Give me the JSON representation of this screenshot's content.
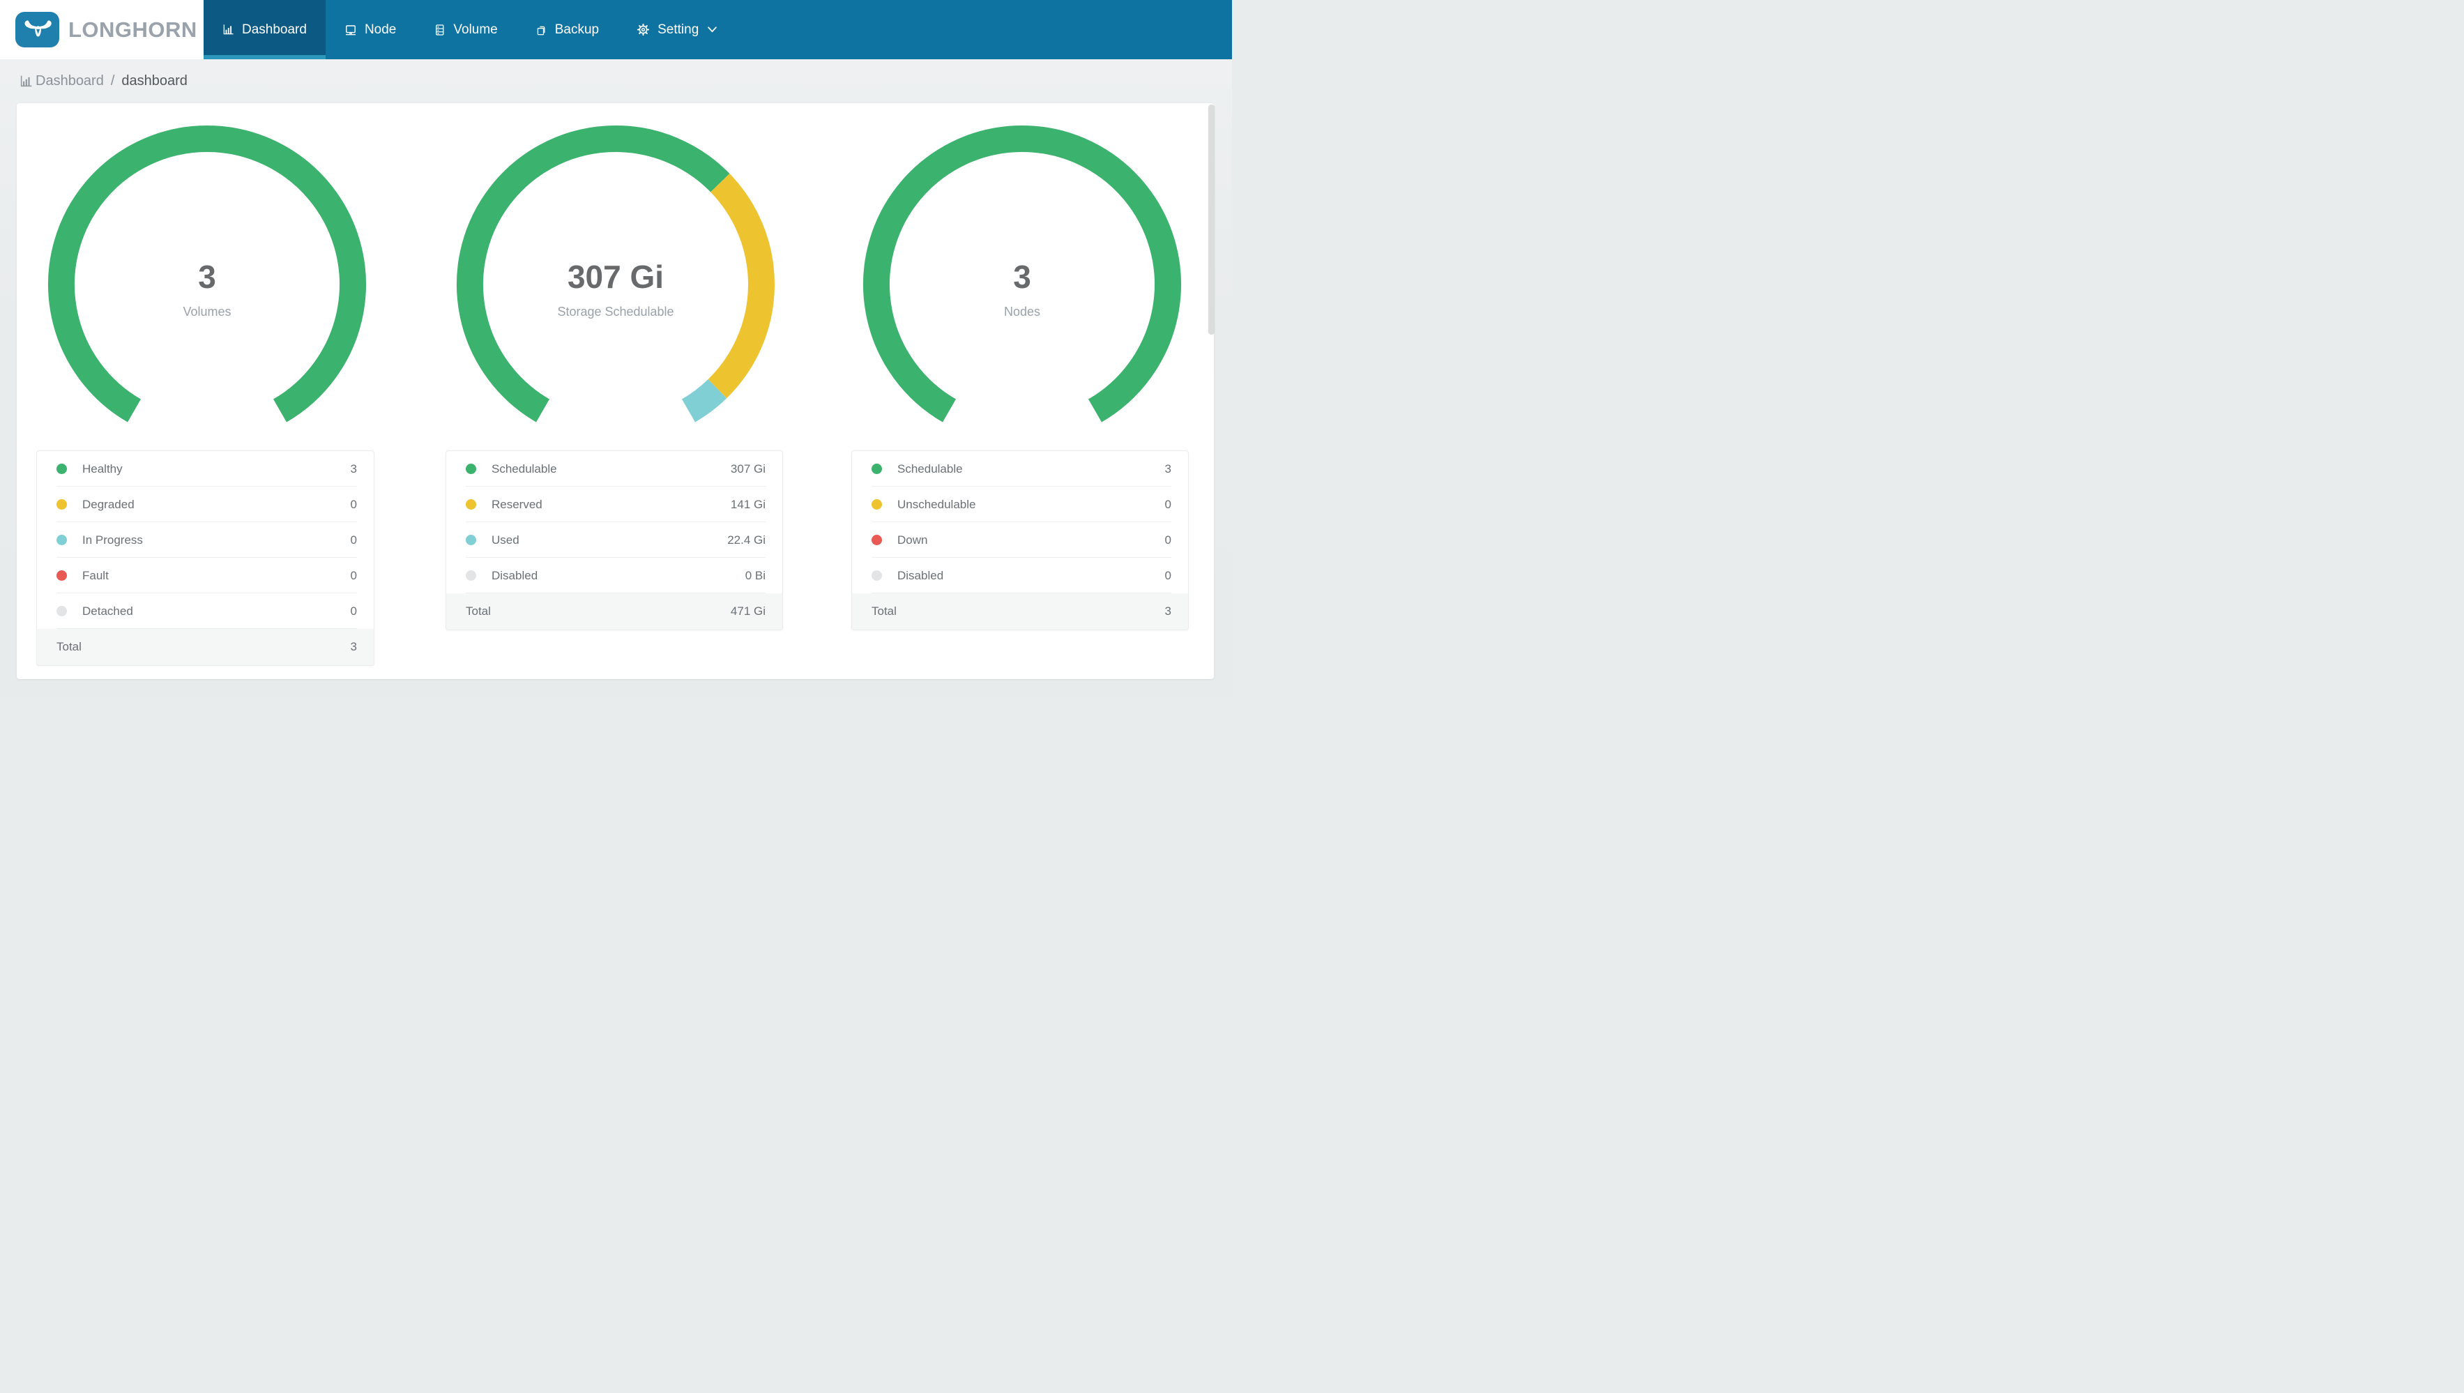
{
  "brand": {
    "name": "LONGHORN",
    "logo_icon": "longhorn-bull-icon"
  },
  "nav": {
    "items": [
      {
        "id": "dashboard",
        "label": "Dashboard",
        "icon": "bar-chart-icon",
        "active": true,
        "dropdown": false
      },
      {
        "id": "node",
        "label": "Node",
        "icon": "node-icon",
        "active": false,
        "dropdown": false
      },
      {
        "id": "volume",
        "label": "Volume",
        "icon": "volume-icon",
        "active": false,
        "dropdown": false
      },
      {
        "id": "backup",
        "label": "Backup",
        "icon": "backup-icon",
        "active": false,
        "dropdown": false
      },
      {
        "id": "setting",
        "label": "Setting",
        "icon": "gear-icon",
        "active": false,
        "dropdown": true
      }
    ]
  },
  "breadcrumb": {
    "icon": "bar-chart-icon",
    "root": "Dashboard",
    "separator": "/",
    "current": "dashboard"
  },
  "colors": {
    "navbar_bg": "#0f73a2",
    "navbar_active_bg": "#0c5a84",
    "navbar_active_underline": "#2b97bb",
    "logo_blue": "#2080ad",
    "brand_text": "#9aa3ab",
    "green": "#3bb26d",
    "yellow": "#eec330",
    "teal": "#80cfd4",
    "red": "#e95a55",
    "gray": "#e2e4e6",
    "number_text": "#67696b",
    "muted_text": "#9aa1a8",
    "table_text": "#6a7075",
    "total_row_bg": "#f5f6f6",
    "page_bg": "#e9eced",
    "card_bg": "#ffffff"
  },
  "chart_data": [
    {
      "id": "volumes",
      "type": "gauge",
      "center_value": "3",
      "center_label": "Volumes",
      "arc_span_deg": 300,
      "segments": [
        {
          "label": "Healthy",
          "value": 3,
          "color": "green"
        },
        {
          "label": "Degraded",
          "value": 0,
          "color": "yellow"
        },
        {
          "label": "In Progress",
          "value": 0,
          "color": "teal"
        },
        {
          "label": "Fault",
          "value": 0,
          "color": "red"
        },
        {
          "label": "Detached",
          "value": 0,
          "color": "gray"
        }
      ],
      "legend_rows": [
        {
          "label": "Healthy",
          "value": "3",
          "color": "green"
        },
        {
          "label": "Degraded",
          "value": "0",
          "color": "yellow"
        },
        {
          "label": "In Progress",
          "value": "0",
          "color": "teal"
        },
        {
          "label": "Fault",
          "value": "0",
          "color": "red"
        },
        {
          "label": "Detached",
          "value": "0",
          "color": "gray"
        }
      ],
      "total": {
        "label": "Total",
        "value": "3"
      }
    },
    {
      "id": "storage",
      "type": "gauge",
      "center_value": "307 Gi",
      "center_label": "Storage Schedulable",
      "arc_span_deg": 300,
      "segments": [
        {
          "label": "Schedulable",
          "value": 307,
          "color": "green"
        },
        {
          "label": "Reserved",
          "value": 141,
          "color": "yellow"
        },
        {
          "label": "Used",
          "value": 22.4,
          "color": "teal"
        },
        {
          "label": "Disabled",
          "value": 0,
          "color": "gray"
        }
      ],
      "legend_rows": [
        {
          "label": "Schedulable",
          "value": "307 Gi",
          "color": "green"
        },
        {
          "label": "Reserved",
          "value": "141 Gi",
          "color": "yellow"
        },
        {
          "label": "Used",
          "value": "22.4 Gi",
          "color": "teal"
        },
        {
          "label": "Disabled",
          "value": "0 Bi",
          "color": "gray"
        }
      ],
      "total": {
        "label": "Total",
        "value": "471 Gi"
      }
    },
    {
      "id": "nodes",
      "type": "gauge",
      "center_value": "3",
      "center_label": "Nodes",
      "arc_span_deg": 300,
      "segments": [
        {
          "label": "Schedulable",
          "value": 3,
          "color": "green"
        },
        {
          "label": "Unschedulable",
          "value": 0,
          "color": "yellow"
        },
        {
          "label": "Down",
          "value": 0,
          "color": "red"
        },
        {
          "label": "Disabled",
          "value": 0,
          "color": "gray"
        }
      ],
      "legend_rows": [
        {
          "label": "Schedulable",
          "value": "3",
          "color": "green"
        },
        {
          "label": "Unschedulable",
          "value": "0",
          "color": "yellow"
        },
        {
          "label": "Down",
          "value": "0",
          "color": "red"
        },
        {
          "label": "Disabled",
          "value": "0",
          "color": "gray"
        }
      ],
      "total": {
        "label": "Total",
        "value": "3"
      }
    }
  ]
}
